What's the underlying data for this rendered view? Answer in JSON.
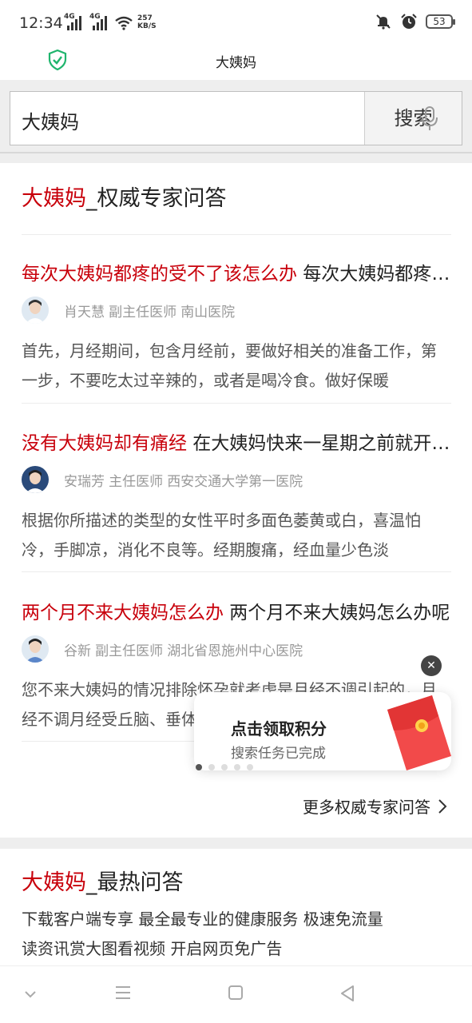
{
  "status_bar": {
    "time": "12:34",
    "network_1": "4G",
    "network_2": "4G",
    "speed_value": "257",
    "speed_unit": "KB/S",
    "battery": "53"
  },
  "url_bar": {
    "title": "大姨妈"
  },
  "search": {
    "query": "大姨妈",
    "button": "搜索"
  },
  "expert_section": {
    "title_keyword": "大姨妈",
    "title_rest": "_权威专家问答",
    "items": [
      {
        "title_red": "每次大姨妈都疼的受不了该怎么办",
        "title_black": " 每次大姨妈都疼的受不了该怎么办",
        "doctor_name": "肖天慧",
        "doctor_title": "副主任医师",
        "hospital": "南山医院",
        "body": "首先，月经期间，包含月经前，要做好相关的准备工作，第一步，不要吃太过辛辣的，或者是喝冷食。做好保暖"
      },
      {
        "title_red": "没有大姨妈却有痛经",
        "title_black": " 在大姨妈快来一星期之前就开始痛经",
        "doctor_name": "安瑞芳",
        "doctor_title": "主任医师",
        "hospital": "西安交通大学第一医院",
        "body": "根据你所描述的类型的女性平时多面色萎黄或白，喜温怕冷，手脚凉，消化不良等。经期腹痛，经血量少色淡"
      },
      {
        "title_red": "两个月不来大姨妈怎么办",
        "title_black": " 两个月不来大姨妈怎么办呢",
        "doctor_name": "谷新",
        "doctor_title": "副主任医师",
        "hospital": "湖北省恩施州中心医院",
        "body": "您不来大姨妈的情况排除怀孕就考虑是月经不调引起的，月经不调月经受丘脑、垂体、卵巢性腺轴的调节"
      }
    ],
    "more_label": "更多权威专家问答"
  },
  "popup": {
    "title": "点击领取积分",
    "subtitle": "搜索任务已完成"
  },
  "hot_section": {
    "title_keyword": "大姨妈",
    "title_rest": "_最热问答",
    "promo_line1": "下载客户端专享 最全最专业的健康服务 极速免流量",
    "promo_line2": "读资讯赏大图看视频 开启网页免广告"
  },
  "icons": {
    "shield": "shield-check-icon",
    "mic": "microphone-icon",
    "more": "chevron-right-icon",
    "close": "close-icon",
    "red_packet": "red-packet-icon"
  },
  "colors": {
    "accent_red": "#c8000b",
    "shield_green": "#1fb56d"
  }
}
